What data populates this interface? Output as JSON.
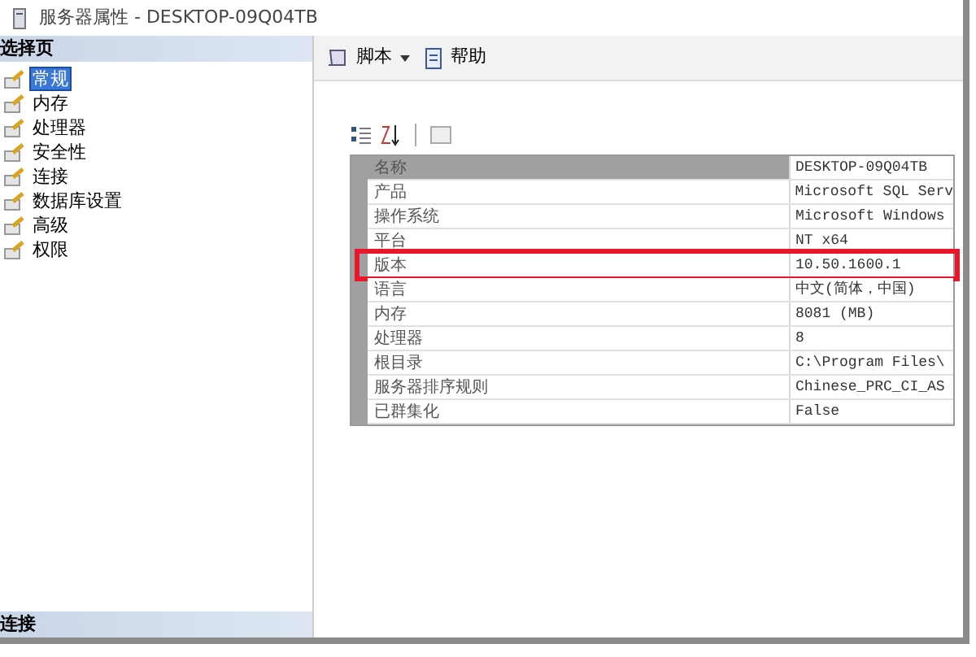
{
  "window": {
    "title": "服务器属性 - DESKTOP-09Q04TB"
  },
  "sidebar": {
    "header": "选择页",
    "items": [
      {
        "label": "常规",
        "selected": true
      },
      {
        "label": "内存",
        "selected": false
      },
      {
        "label": "处理器",
        "selected": false
      },
      {
        "label": "安全性",
        "selected": false
      },
      {
        "label": "连接",
        "selected": false
      },
      {
        "label": "数据库设置",
        "selected": false
      },
      {
        "label": "高级",
        "selected": false
      },
      {
        "label": "权限",
        "selected": false
      }
    ],
    "footer_header": "连接"
  },
  "toolbar": {
    "script_button": "脚本",
    "help_button": "帮助"
  },
  "properties": {
    "rows": [
      {
        "name": "名称",
        "value": "DESKTOP-09Q04TB",
        "selected": true,
        "highlighted": false
      },
      {
        "name": "产品",
        "value": "Microsoft SQL Serv",
        "selected": false,
        "highlighted": false
      },
      {
        "name": "操作系统",
        "value": "Microsoft Windows",
        "selected": false,
        "highlighted": false
      },
      {
        "name": "平台",
        "value": "NT x64",
        "selected": false,
        "highlighted": false
      },
      {
        "name": "版本",
        "value": "10.50.1600.1",
        "selected": false,
        "highlighted": true
      },
      {
        "name": "语言",
        "value": "中文(简体，中国)",
        "selected": false,
        "highlighted": false
      },
      {
        "name": "内存",
        "value": "8081 (MB)",
        "selected": false,
        "highlighted": false
      },
      {
        "name": "处理器",
        "value": "8",
        "selected": false,
        "highlighted": false
      },
      {
        "name": "根目录",
        "value": "C:\\Program Files\\",
        "selected": false,
        "highlighted": false
      },
      {
        "name": "服务器排序规则",
        "value": "Chinese_PRC_CI_AS",
        "selected": false,
        "highlighted": false
      },
      {
        "name": "已群集化",
        "value": "False",
        "selected": false,
        "highlighted": false
      }
    ]
  }
}
